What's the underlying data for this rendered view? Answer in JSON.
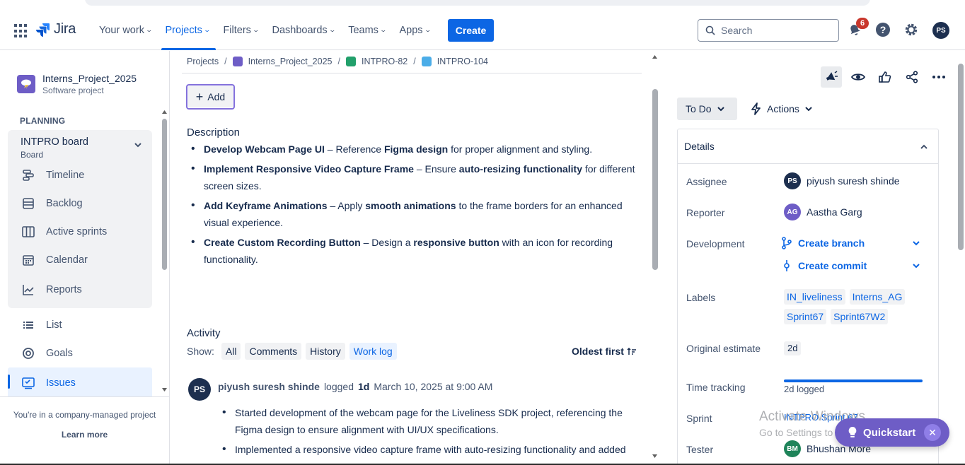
{
  "header": {
    "logo_text": "Jira",
    "nav": [
      {
        "label": "Your work"
      },
      {
        "label": "Projects"
      },
      {
        "label": "Filters"
      },
      {
        "label": "Dashboards"
      },
      {
        "label": "Teams"
      },
      {
        "label": "Apps"
      }
    ],
    "create_label": "Create",
    "search_placeholder": "Search",
    "notification_count": "6",
    "user_initials": "PS"
  },
  "sidebar": {
    "project_name": "Interns_Project_2025",
    "project_type": "Software project",
    "section": "PLANNING",
    "board_title": "INTPRO board",
    "board_sub": "Board",
    "items": [
      {
        "label": "Timeline",
        "icon": "timeline-icon"
      },
      {
        "label": "Backlog",
        "icon": "backlog-icon"
      },
      {
        "label": "Active sprints",
        "icon": "board-icon"
      },
      {
        "label": "Calendar",
        "icon": "calendar-icon"
      },
      {
        "label": "Reports",
        "icon": "reports-icon"
      },
      {
        "label": "List",
        "icon": "list-icon"
      },
      {
        "label": "Goals",
        "icon": "goals-icon"
      },
      {
        "label": "Issues",
        "icon": "issues-icon"
      }
    ],
    "footer_text": "You're in a company-managed project",
    "learn_more": "Learn more"
  },
  "breadcrumb": [
    "Projects",
    "Interns_Project_2025",
    "INTPRO-82",
    "INTPRO-104"
  ],
  "main": {
    "add_label": "Add",
    "description_title": "Description",
    "description_items": [
      {
        "b1": "Develop Webcam Page UI",
        "t1": " – Reference ",
        "b2": "Figma design",
        "t2": " for proper alignment and styling."
      },
      {
        "b1": "Implement Responsive Video Capture Frame",
        "t1": " – Ensure ",
        "b2": "auto-resizing functionality",
        "t2": " for different screen sizes."
      },
      {
        "b1": "Add Keyframe Animations",
        "t1": " – Apply ",
        "b2": "smooth animations",
        "t2": " to the frame borders for an enhanced visual experience."
      },
      {
        "b1": "Create Custom Recording Button",
        "t1": " – Design a ",
        "b2": "responsive button",
        "t2": " with an icon for recording functionality."
      }
    ],
    "activity_title": "Activity",
    "show_label": "Show:",
    "filters": [
      "All",
      "Comments",
      "History",
      "Work log"
    ],
    "sort_label": "Oldest first",
    "log": {
      "initials": "PS",
      "author": "piyush suresh shinde",
      "action": "logged",
      "duration": "1d",
      "date": "March 10, 2025 at 9:00 AM",
      "items": [
        "Started development of the webcam page for the Liveliness SDK project, referencing the Figma design to ensure alignment with UI/UX specifications.",
        "Implemented a responsive video capture frame with auto-resizing functionality and added"
      ]
    }
  },
  "right": {
    "status": "To Do",
    "actions_label": "Actions",
    "details_title": "Details",
    "assignee_label": "Assignee",
    "assignee_initials": "PS",
    "assignee": "piyush suresh shinde",
    "reporter_label": "Reporter",
    "reporter_initials": "AG",
    "reporter": "Aastha Garg",
    "development_label": "Development",
    "create_branch": "Create branch",
    "create_commit": "Create commit",
    "labels_label": "Labels",
    "labels": [
      "IN_liveliness",
      "Interns_AG",
      "Sprint67",
      "Sprint67W2"
    ],
    "estimate_label": "Original estimate",
    "estimate": "2d",
    "time_tracking_label": "Time tracking",
    "time_logged": "2d logged",
    "time_tracking_fraction": 1.0,
    "sprint_label": "Sprint",
    "sprint": "INTPRO Sprint 67",
    "tester_label": "Tester",
    "tester_initials": "BM",
    "tester": "Bhushan More"
  },
  "overlay": {
    "watermark_line1": "Activate Windows",
    "watermark_line2": "Go to Settings to activate Windows.",
    "quickstart": "Quickstart"
  },
  "colors": {
    "accent": "#0c66e4",
    "quickstart": "#6e5dc6",
    "avatar_dark": "#1d2f4f",
    "avatar_ag": "#6e5dc6",
    "avatar_bm": "#1f845a"
  }
}
